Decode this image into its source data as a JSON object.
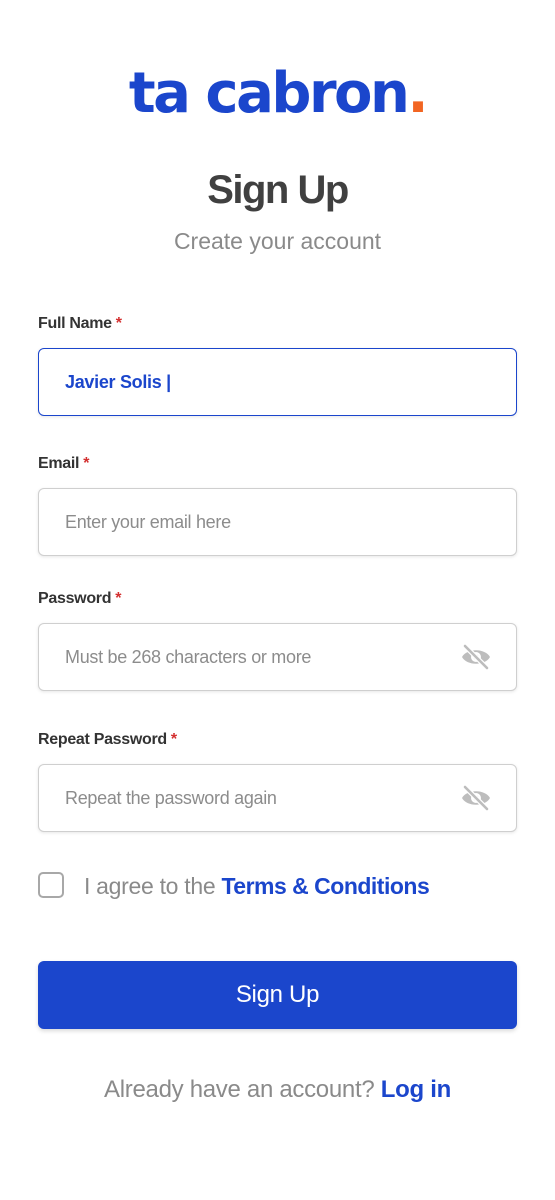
{
  "brand": {
    "logo_text": "ta cabron",
    "logo_dot": ".",
    "primary_color": "#1b46cc",
    "accent_color": "#f26522",
    "required_color": "#d32f2f"
  },
  "header": {
    "title": "Sign Up",
    "subtitle": "Create your account"
  },
  "form": {
    "required_marker": "*",
    "full_name": {
      "label": "Full Name",
      "value": "Javier Solis |"
    },
    "email": {
      "label": "Email",
      "placeholder": "Enter your email here"
    },
    "password": {
      "label": "Password",
      "placeholder": "Must be 268 characters or more",
      "toggle_icon": "eye-slash-icon"
    },
    "repeat_password": {
      "label": "Repeat Password",
      "placeholder": "Repeat the password again",
      "toggle_icon": "eye-slash-icon"
    },
    "agree": {
      "checked": false,
      "text": "I agree to the",
      "link_text": "Terms & Conditions"
    },
    "submit_label": "Sign Up"
  },
  "footer": {
    "prompt": "Already have an account?",
    "link_text": "Log in"
  }
}
